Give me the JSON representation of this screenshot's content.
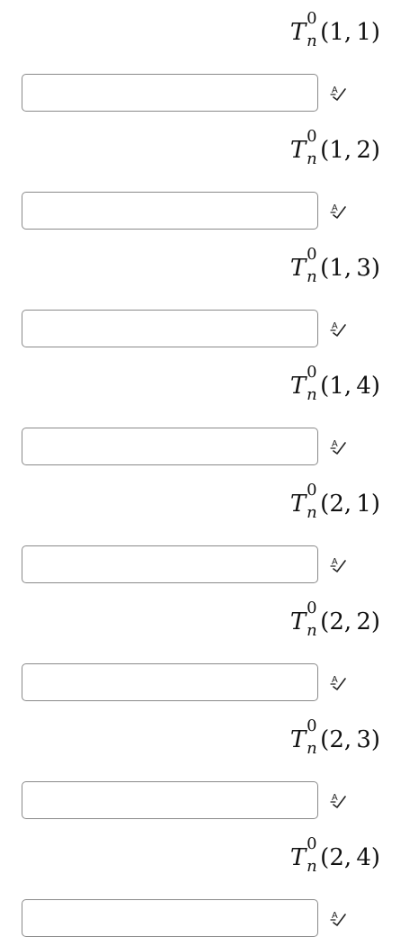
{
  "icon": "spell-check-icon",
  "fields": [
    {
      "symbol": "T",
      "superscript": "0",
      "subscript": "n",
      "args": "(1, 1)",
      "value": "",
      "placeholder": ""
    },
    {
      "symbol": "T",
      "superscript": "0",
      "subscript": "n",
      "args": "(1, 2)",
      "value": "",
      "placeholder": ""
    },
    {
      "symbol": "T",
      "superscript": "0",
      "subscript": "n",
      "args": "(1, 3)",
      "value": "",
      "placeholder": ""
    },
    {
      "symbol": "T",
      "superscript": "0",
      "subscript": "n",
      "args": "(1, 4)",
      "value": "",
      "placeholder": ""
    },
    {
      "symbol": "T",
      "superscript": "0",
      "subscript": "n",
      "args": "(2, 1)",
      "value": "",
      "placeholder": ""
    },
    {
      "symbol": "T",
      "superscript": "0",
      "subscript": "n",
      "args": "(2, 2)",
      "value": "",
      "placeholder": ""
    },
    {
      "symbol": "T",
      "superscript": "0",
      "subscript": "n",
      "args": "(2, 3)",
      "value": "",
      "placeholder": ""
    },
    {
      "symbol": "T",
      "superscript": "0",
      "subscript": "n",
      "args": "(2, 4)",
      "value": "",
      "placeholder": ""
    }
  ]
}
